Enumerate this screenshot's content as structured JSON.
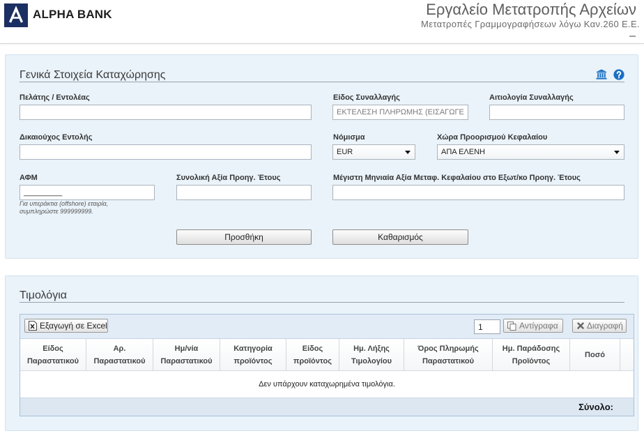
{
  "header": {
    "brand_name": "ALPHA BANK",
    "title": "Εργαλείο Μετατροπής Αρχείων",
    "subtitle": "Μετατροπές Γραμμογραφήσεων λόγω Καν.260 Ε.Ε."
  },
  "general": {
    "title": "Γενικά Στοιχεία Καταχώρησης",
    "client": {
      "label": "Πελάτης / Εντολέας",
      "value": ""
    },
    "transaction_type": {
      "label": "Είδος Συναλλαγής",
      "value": "ΕΚΤΕΛΕΣΗ ΠΛΗΡΩΜΗΣ (ΕΙΣΑΓΩΓΕ"
    },
    "transaction_reason": {
      "label": "Αιτιολογία Συναλλαγής",
      "value": ""
    },
    "beneficiary": {
      "label": "Δικαιούχος Εντολής",
      "value": ""
    },
    "currency": {
      "label": "Νόμισμα",
      "selected": "EUR"
    },
    "destination_country": {
      "label": "Χώρα Προορισμού Κεφαλαίου",
      "selected": "ΑΠΑ ΕΛΕΝΗ"
    },
    "tax_id": {
      "label": "ΑΦΜ",
      "value": "_________",
      "hint": "Για υπεράκτια (offshore) εταιρία, συμπληρώστε 999999999."
    },
    "prev_year_total": {
      "label": "Συνολική Αξία Προηγ. Έτους",
      "value": ""
    },
    "max_monthly": {
      "label": "Μέγιστη Μηνιαία Αξία Μεταφ. Κεφαλαίου στο Εξωτ/κο Προηγ. Έτους",
      "value": ""
    },
    "add_button": "Προσθήκη",
    "clear_button": "Καθαρισμός"
  },
  "invoices": {
    "title": "Τιμολόγια",
    "toolbar": {
      "export_button": "Εξαγωγή σε Excel",
      "copies_count": "1",
      "copies_button": "Αντίγραφα",
      "delete_button": "Διαγραφή"
    },
    "columns": [
      "Είδος\nΠαραστατικού",
      "Αρ.\nΠαραστατικού",
      "Ημ/νία\nΠαραστατικού",
      "Κατηγορία\nπροϊόντος",
      "Είδος\nπροϊόντος",
      "Ημ. Λήξης\nΤιμολογίου",
      "Όρος Πληρωμής\nΠαραστατικού",
      "Ημ. Παράδοσης\nΠροϊόντος",
      "Ποσό"
    ],
    "rows": [],
    "empty_message": "Δεν υπάρχουν καταχωρημένα τιμολόγια.",
    "total_label": "Σύνολο:"
  },
  "icons": {
    "logo": "alpha-bank-logo",
    "bank": "bank-icon",
    "help": "help-icon",
    "export": "excel-icon",
    "copy": "copy-icon",
    "delete": "delete-icon",
    "select": "chevron-down-icon"
  },
  "colors": {
    "logo": "#1b2f63",
    "accent": "#1a6fc2",
    "panel_background": "#eaf3fa",
    "grid_footer": "#dce7f2"
  }
}
